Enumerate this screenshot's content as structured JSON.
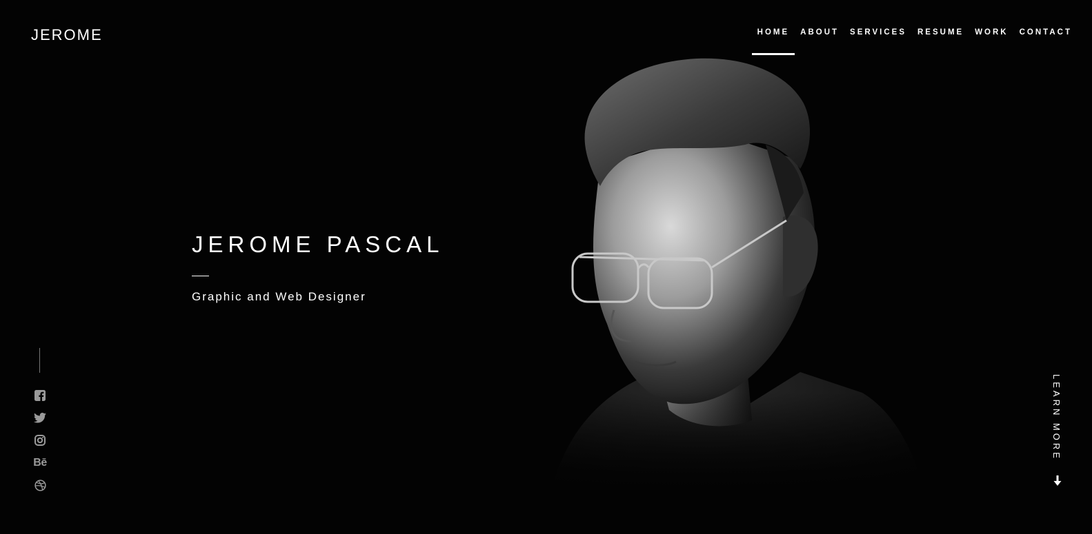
{
  "header": {
    "logo": "JEROME",
    "nav": [
      {
        "label": "HOME",
        "active": true
      },
      {
        "label": "ABOUT",
        "active": false
      },
      {
        "label": "SERVICES",
        "active": false
      },
      {
        "label": "RESUME",
        "active": false
      },
      {
        "label": "WORK",
        "active": false
      },
      {
        "label": "CONTACT",
        "active": false
      }
    ]
  },
  "hero": {
    "name": "JEROME PASCAL",
    "role": "Graphic and Web Designer"
  },
  "social": {
    "icons": [
      "facebook-icon",
      "twitter-icon",
      "instagram-icon",
      "behance-icon",
      "dribbble-icon"
    ],
    "behance_glyph": "Bē"
  },
  "scroll": {
    "label": "LEARN MORE",
    "icon": "arrow-down-icon"
  },
  "colors": {
    "background": "#030303",
    "text": "#ffffff",
    "muted": "#9a9a9a"
  }
}
